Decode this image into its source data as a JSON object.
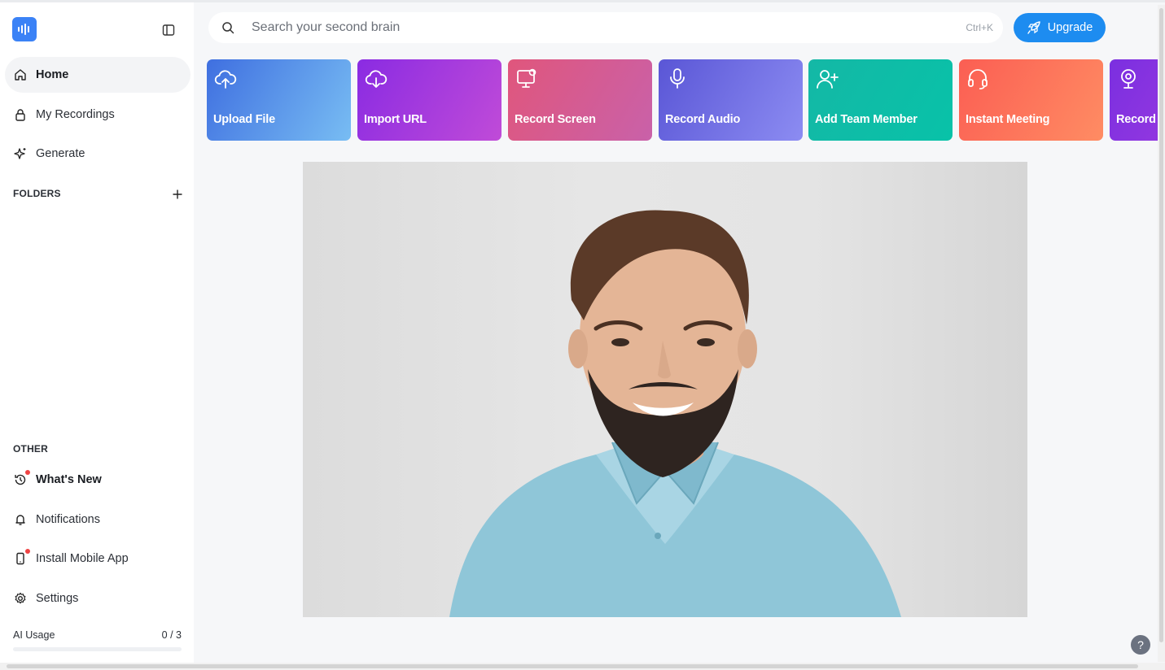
{
  "sidebar": {
    "logo_icon": "audio-wave-icon",
    "nav": [
      {
        "label": "Home",
        "icon": "home-icon"
      },
      {
        "label": "My Recordings",
        "icon": "lock-icon"
      },
      {
        "label": "Generate",
        "icon": "sparkles-icon"
      }
    ],
    "folders_label": "FOLDERS",
    "other_label": "OTHER",
    "other": [
      {
        "label": "What's New",
        "icon": "history-icon"
      },
      {
        "label": "Notifications",
        "icon": "bell-icon"
      },
      {
        "label": "Install Mobile App",
        "icon": "smartphone-icon"
      },
      {
        "label": "Settings",
        "icon": "gear-icon"
      }
    ],
    "usage": {
      "label": "AI Usage",
      "count": "0 / 3",
      "fraction": 0
    }
  },
  "search": {
    "placeholder": "Search your second brain",
    "shortcut": "Ctrl+K"
  },
  "upgrade": {
    "label": "Upgrade",
    "icon": "rocket-icon"
  },
  "actions": [
    {
      "label": "Upload File",
      "icon": "cloud-upload-icon",
      "colors": [
        "#3f6fe0",
        "#78bdf3"
      ]
    },
    {
      "label": "Import URL",
      "icon": "cloud-download-icon",
      "colors": [
        "#8a2be2",
        "#c04bd8"
      ]
    },
    {
      "label": "Record Screen",
      "icon": "monitor-icon",
      "colors": [
        "#e0567c",
        "#c961a9"
      ]
    },
    {
      "label": "Record Audio",
      "icon": "microphone-icon",
      "colors": [
        "#5a56d6",
        "#8c8cf2"
      ]
    },
    {
      "label": "Add Team Member",
      "icon": "user-plus-icon",
      "colors": [
        "#14b8a6",
        "#08c2a8"
      ]
    },
    {
      "label": "Instant Meeting",
      "icon": "headset-icon",
      "colors": [
        "#fb5e53",
        "#ff8c63"
      ]
    },
    {
      "label": "Record Video",
      "icon": "webcam-icon",
      "colors": [
        "#7b2fe0",
        "#a63ee0"
      ]
    }
  ],
  "help_label": "?"
}
